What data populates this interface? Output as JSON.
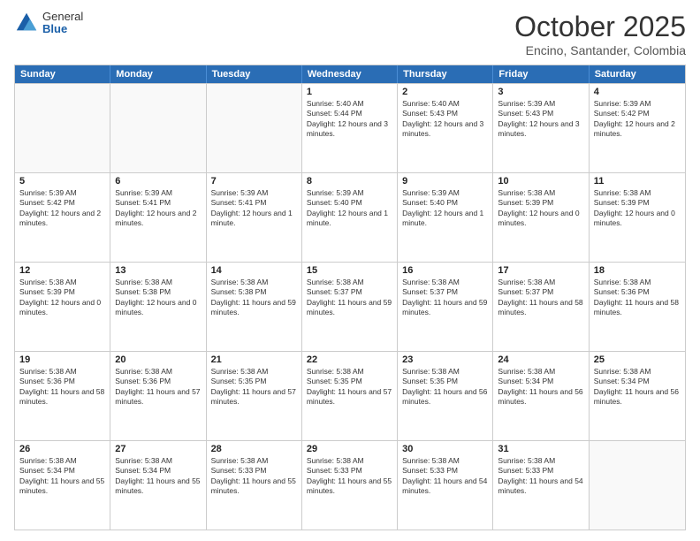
{
  "logo": {
    "general": "General",
    "blue": "Blue"
  },
  "header": {
    "month": "October 2025",
    "location": "Encino, Santander, Colombia"
  },
  "days_of_week": [
    "Sunday",
    "Monday",
    "Tuesday",
    "Wednesday",
    "Thursday",
    "Friday",
    "Saturday"
  ],
  "weeks": [
    [
      {
        "day": "",
        "sunrise": "",
        "sunset": "",
        "daylight": "",
        "empty": true
      },
      {
        "day": "",
        "sunrise": "",
        "sunset": "",
        "daylight": "",
        "empty": true
      },
      {
        "day": "",
        "sunrise": "",
        "sunset": "",
        "daylight": "",
        "empty": true
      },
      {
        "day": "1",
        "sunrise": "Sunrise: 5:40 AM",
        "sunset": "Sunset: 5:44 PM",
        "daylight": "Daylight: 12 hours and 3 minutes.",
        "empty": false
      },
      {
        "day": "2",
        "sunrise": "Sunrise: 5:40 AM",
        "sunset": "Sunset: 5:43 PM",
        "daylight": "Daylight: 12 hours and 3 minutes.",
        "empty": false
      },
      {
        "day": "3",
        "sunrise": "Sunrise: 5:39 AM",
        "sunset": "Sunset: 5:43 PM",
        "daylight": "Daylight: 12 hours and 3 minutes.",
        "empty": false
      },
      {
        "day": "4",
        "sunrise": "Sunrise: 5:39 AM",
        "sunset": "Sunset: 5:42 PM",
        "daylight": "Daylight: 12 hours and 2 minutes.",
        "empty": false
      }
    ],
    [
      {
        "day": "5",
        "sunrise": "Sunrise: 5:39 AM",
        "sunset": "Sunset: 5:42 PM",
        "daylight": "Daylight: 12 hours and 2 minutes.",
        "empty": false
      },
      {
        "day": "6",
        "sunrise": "Sunrise: 5:39 AM",
        "sunset": "Sunset: 5:41 PM",
        "daylight": "Daylight: 12 hours and 2 minutes.",
        "empty": false
      },
      {
        "day": "7",
        "sunrise": "Sunrise: 5:39 AM",
        "sunset": "Sunset: 5:41 PM",
        "daylight": "Daylight: 12 hours and 1 minute.",
        "empty": false
      },
      {
        "day": "8",
        "sunrise": "Sunrise: 5:39 AM",
        "sunset": "Sunset: 5:40 PM",
        "daylight": "Daylight: 12 hours and 1 minute.",
        "empty": false
      },
      {
        "day": "9",
        "sunrise": "Sunrise: 5:39 AM",
        "sunset": "Sunset: 5:40 PM",
        "daylight": "Daylight: 12 hours and 1 minute.",
        "empty": false
      },
      {
        "day": "10",
        "sunrise": "Sunrise: 5:38 AM",
        "sunset": "Sunset: 5:39 PM",
        "daylight": "Daylight: 12 hours and 0 minutes.",
        "empty": false
      },
      {
        "day": "11",
        "sunrise": "Sunrise: 5:38 AM",
        "sunset": "Sunset: 5:39 PM",
        "daylight": "Daylight: 12 hours and 0 minutes.",
        "empty": false
      }
    ],
    [
      {
        "day": "12",
        "sunrise": "Sunrise: 5:38 AM",
        "sunset": "Sunset: 5:39 PM",
        "daylight": "Daylight: 12 hours and 0 minutes.",
        "empty": false
      },
      {
        "day": "13",
        "sunrise": "Sunrise: 5:38 AM",
        "sunset": "Sunset: 5:38 PM",
        "daylight": "Daylight: 12 hours and 0 minutes.",
        "empty": false
      },
      {
        "day": "14",
        "sunrise": "Sunrise: 5:38 AM",
        "sunset": "Sunset: 5:38 PM",
        "daylight": "Daylight: 11 hours and 59 minutes.",
        "empty": false
      },
      {
        "day": "15",
        "sunrise": "Sunrise: 5:38 AM",
        "sunset": "Sunset: 5:37 PM",
        "daylight": "Daylight: 11 hours and 59 minutes.",
        "empty": false
      },
      {
        "day": "16",
        "sunrise": "Sunrise: 5:38 AM",
        "sunset": "Sunset: 5:37 PM",
        "daylight": "Daylight: 11 hours and 59 minutes.",
        "empty": false
      },
      {
        "day": "17",
        "sunrise": "Sunrise: 5:38 AM",
        "sunset": "Sunset: 5:37 PM",
        "daylight": "Daylight: 11 hours and 58 minutes.",
        "empty": false
      },
      {
        "day": "18",
        "sunrise": "Sunrise: 5:38 AM",
        "sunset": "Sunset: 5:36 PM",
        "daylight": "Daylight: 11 hours and 58 minutes.",
        "empty": false
      }
    ],
    [
      {
        "day": "19",
        "sunrise": "Sunrise: 5:38 AM",
        "sunset": "Sunset: 5:36 PM",
        "daylight": "Daylight: 11 hours and 58 minutes.",
        "empty": false
      },
      {
        "day": "20",
        "sunrise": "Sunrise: 5:38 AM",
        "sunset": "Sunset: 5:36 PM",
        "daylight": "Daylight: 11 hours and 57 minutes.",
        "empty": false
      },
      {
        "day": "21",
        "sunrise": "Sunrise: 5:38 AM",
        "sunset": "Sunset: 5:35 PM",
        "daylight": "Daylight: 11 hours and 57 minutes.",
        "empty": false
      },
      {
        "day": "22",
        "sunrise": "Sunrise: 5:38 AM",
        "sunset": "Sunset: 5:35 PM",
        "daylight": "Daylight: 11 hours and 57 minutes.",
        "empty": false
      },
      {
        "day": "23",
        "sunrise": "Sunrise: 5:38 AM",
        "sunset": "Sunset: 5:35 PM",
        "daylight": "Daylight: 11 hours and 56 minutes.",
        "empty": false
      },
      {
        "day": "24",
        "sunrise": "Sunrise: 5:38 AM",
        "sunset": "Sunset: 5:34 PM",
        "daylight": "Daylight: 11 hours and 56 minutes.",
        "empty": false
      },
      {
        "day": "25",
        "sunrise": "Sunrise: 5:38 AM",
        "sunset": "Sunset: 5:34 PM",
        "daylight": "Daylight: 11 hours and 56 minutes.",
        "empty": false
      }
    ],
    [
      {
        "day": "26",
        "sunrise": "Sunrise: 5:38 AM",
        "sunset": "Sunset: 5:34 PM",
        "daylight": "Daylight: 11 hours and 55 minutes.",
        "empty": false
      },
      {
        "day": "27",
        "sunrise": "Sunrise: 5:38 AM",
        "sunset": "Sunset: 5:34 PM",
        "daylight": "Daylight: 11 hours and 55 minutes.",
        "empty": false
      },
      {
        "day": "28",
        "sunrise": "Sunrise: 5:38 AM",
        "sunset": "Sunset: 5:33 PM",
        "daylight": "Daylight: 11 hours and 55 minutes.",
        "empty": false
      },
      {
        "day": "29",
        "sunrise": "Sunrise: 5:38 AM",
        "sunset": "Sunset: 5:33 PM",
        "daylight": "Daylight: 11 hours and 55 minutes.",
        "empty": false
      },
      {
        "day": "30",
        "sunrise": "Sunrise: 5:38 AM",
        "sunset": "Sunset: 5:33 PM",
        "daylight": "Daylight: 11 hours and 54 minutes.",
        "empty": false
      },
      {
        "day": "31",
        "sunrise": "Sunrise: 5:38 AM",
        "sunset": "Sunset: 5:33 PM",
        "daylight": "Daylight: 11 hours and 54 minutes.",
        "empty": false
      },
      {
        "day": "",
        "sunrise": "",
        "sunset": "",
        "daylight": "",
        "empty": true
      }
    ]
  ]
}
